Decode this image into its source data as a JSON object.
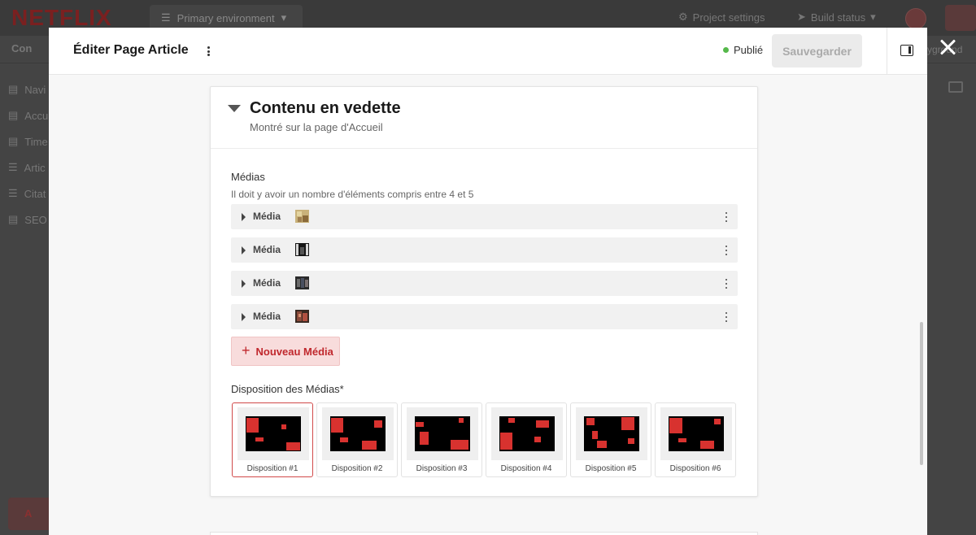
{
  "background": {
    "logo": "NETFLIX",
    "environment": "Primary environment",
    "project_settings": "Project settings",
    "build_status": "Build status",
    "tab_left": "Con",
    "tab_right": "yground",
    "side_items": [
      "Navi",
      "Accu",
      "Time",
      "Artic",
      "Citat",
      "SEO"
    ],
    "side_button": "A"
  },
  "modal": {
    "title": "Éditer Page Article",
    "status": "Publié",
    "save_label": "Sauvegarder",
    "colors": {
      "status_dot": "#55b84a",
      "accent": "#c0282d"
    }
  },
  "section": {
    "title": "Contenu en vedette",
    "subtitle": "Montré sur la page d'Accueil",
    "media_label": "Médias",
    "media_help": "Il doit y avoir un nombre d'éléments compris entre 4 et 5",
    "media_items": [
      {
        "label": "Média",
        "thumb": "photo-thumbnail-1"
      },
      {
        "label": "Média",
        "thumb": "photo-thumbnail-2"
      },
      {
        "label": "Média",
        "thumb": "photo-thumbnail-3"
      },
      {
        "label": "Média",
        "thumb": "photo-thumbnail-4"
      }
    ],
    "new_media_label": "Nouveau Média",
    "layout_label": "Disposition des Médias*",
    "layouts": [
      {
        "name": "Disposition #1",
        "selected": true
      },
      {
        "name": "Disposition #2",
        "selected": false
      },
      {
        "name": "Disposition #3",
        "selected": false
      },
      {
        "name": "Disposition #4",
        "selected": false
      },
      {
        "name": "Disposition #5",
        "selected": false
      },
      {
        "name": "Disposition #6",
        "selected": false
      }
    ]
  }
}
